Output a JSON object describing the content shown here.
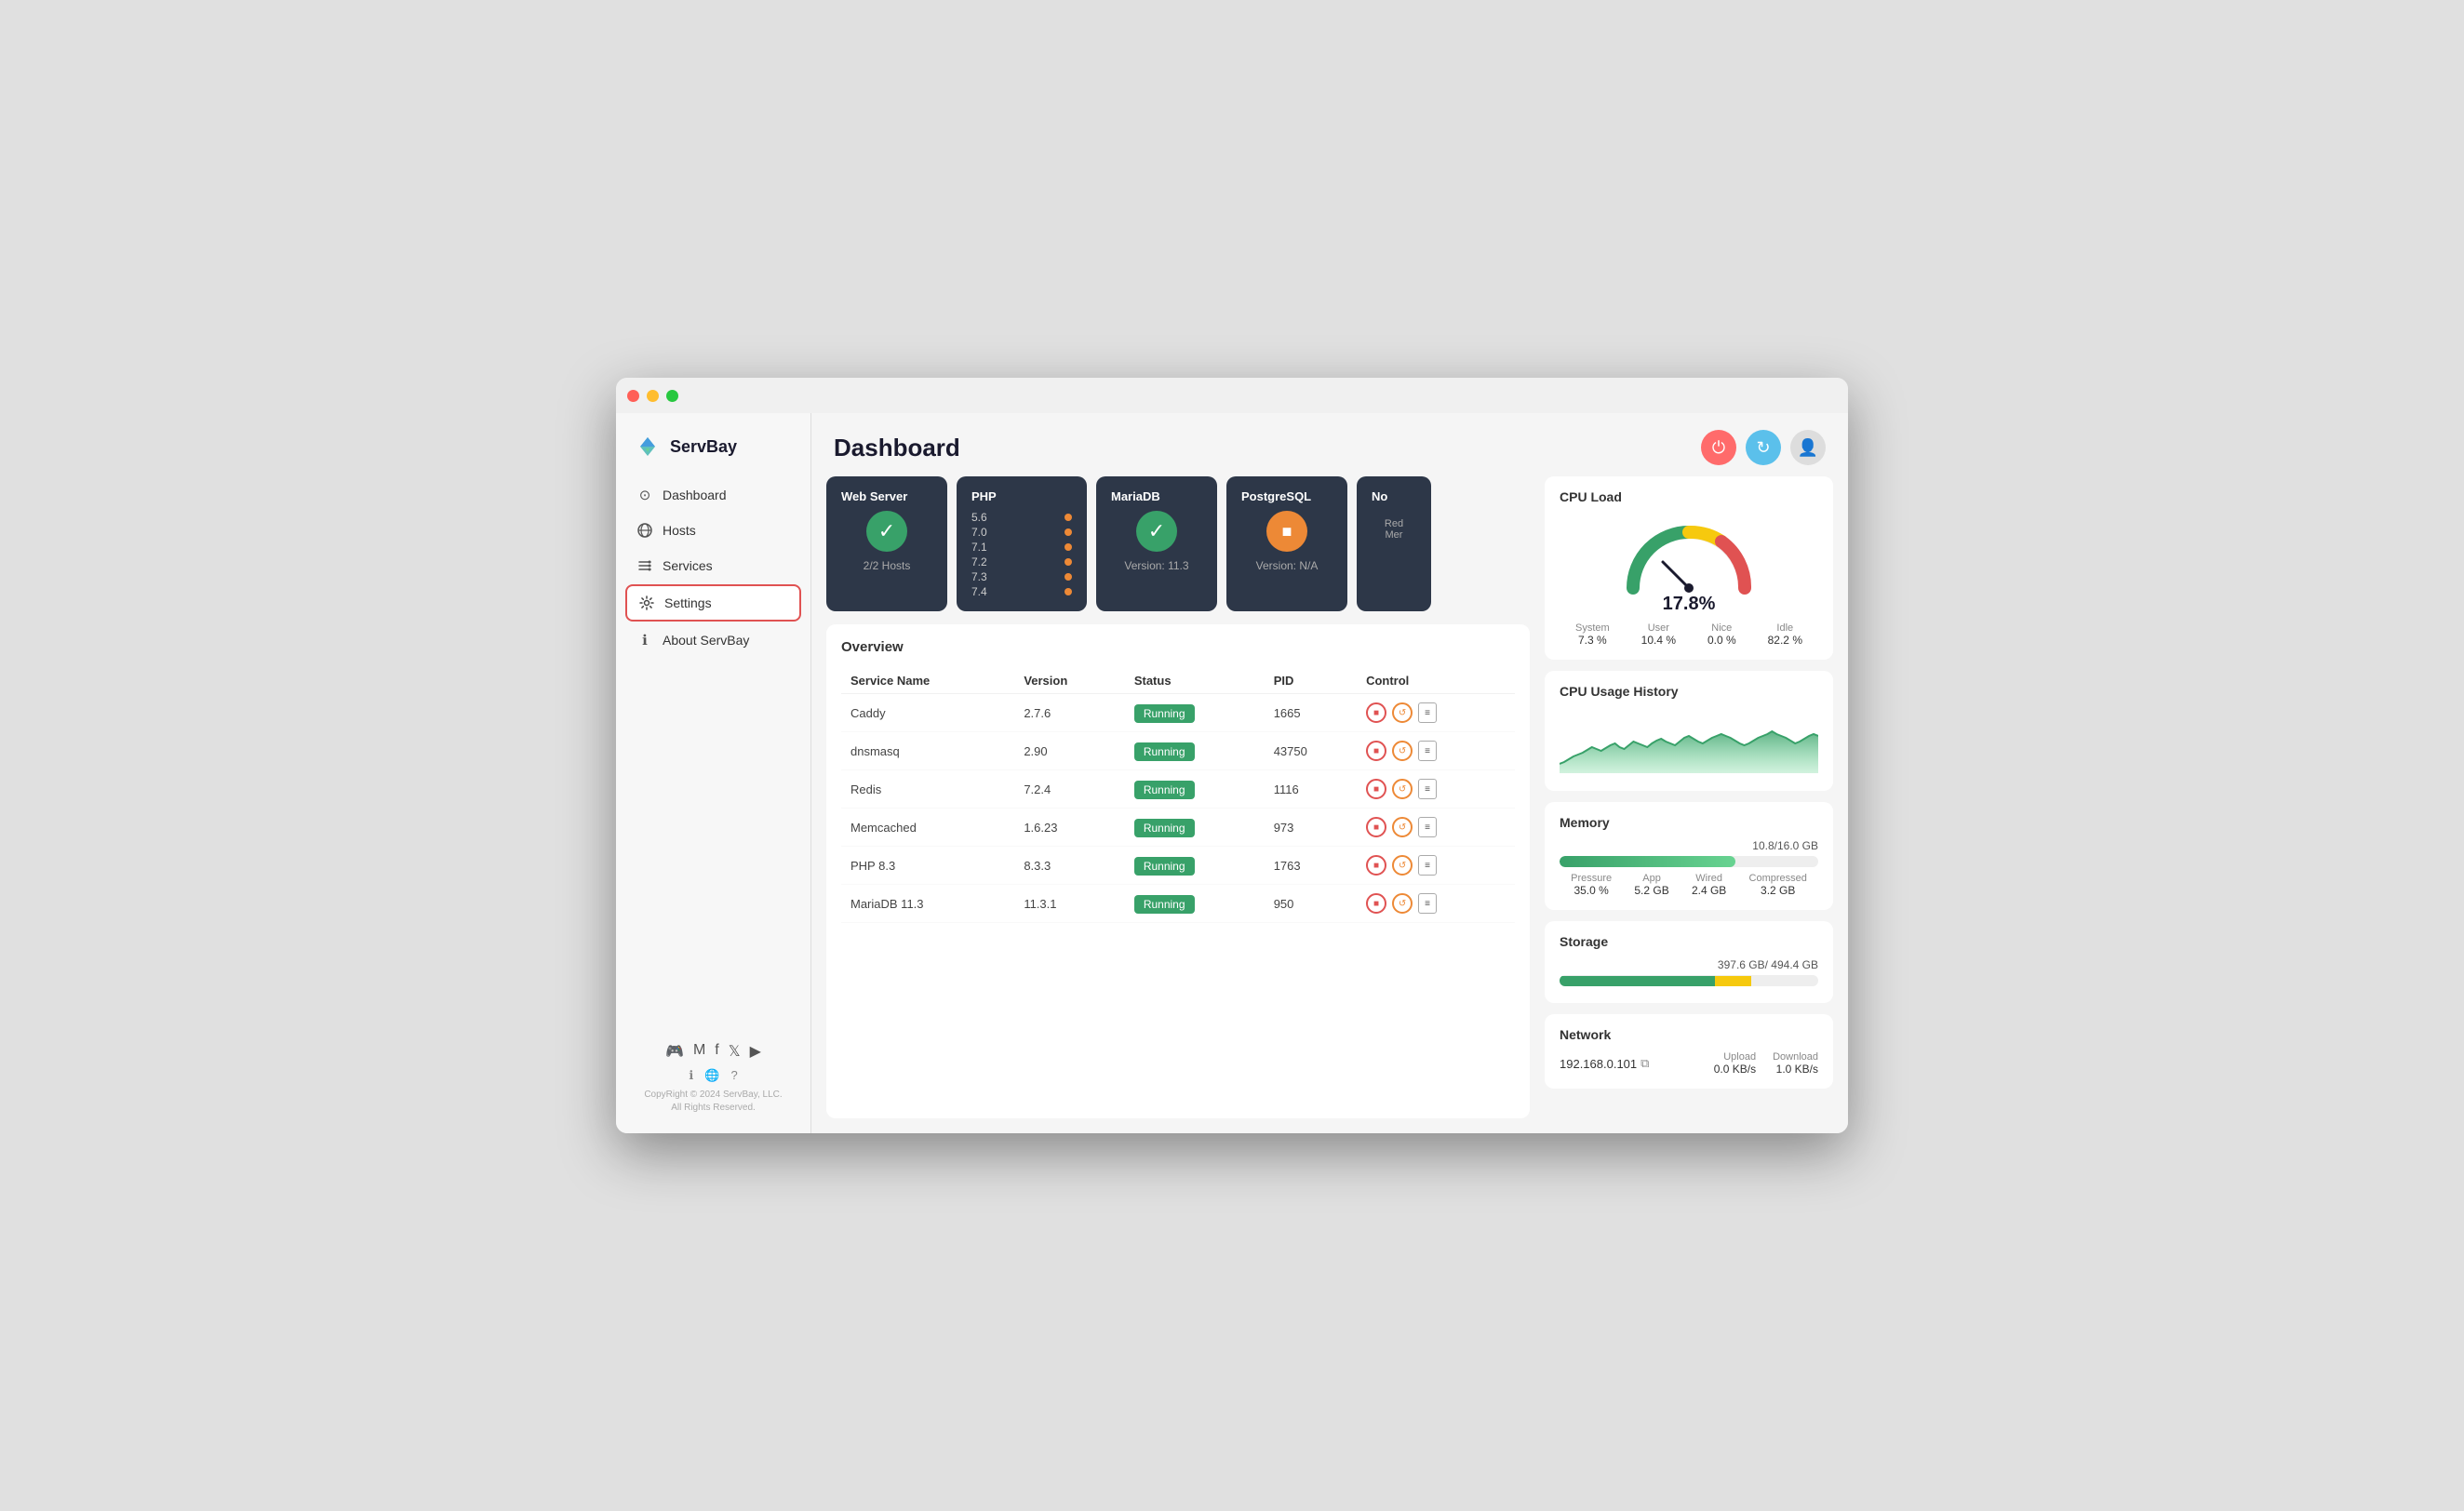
{
  "window": {
    "title": "ServBay Dashboard"
  },
  "sidebar": {
    "logo": "ServBay",
    "nav_items": [
      {
        "id": "dashboard",
        "label": "Dashboard",
        "icon": "⊙",
        "active": false
      },
      {
        "id": "hosts",
        "label": "Hosts",
        "icon": "🌐",
        "active": false
      },
      {
        "id": "services",
        "label": "Services",
        "icon": "⚙",
        "active": false
      },
      {
        "id": "settings",
        "label": "Settings",
        "icon": "⚙",
        "active": true
      },
      {
        "id": "about",
        "label": "About ServBay",
        "icon": "ℹ",
        "active": false
      }
    ],
    "social": [
      "discord",
      "medium",
      "facebook",
      "x",
      "youtube"
    ],
    "footer_links": [
      "ℹ",
      "🌐",
      "?"
    ],
    "copyright": "CopyRight © 2024 ServBay, LLC.\nAll Rights Reserved."
  },
  "header": {
    "title": "Dashboard",
    "buttons": {
      "power": "⏻",
      "refresh": "↻",
      "user": "👤"
    }
  },
  "service_cards": [
    {
      "title": "Web Server",
      "status": "green",
      "icon": "✓",
      "subtitle": "2/2 Hosts"
    },
    {
      "title": "PHP",
      "status": "php",
      "versions": [
        "5.6",
        "7.0",
        "7.1",
        "7.2",
        "7.3",
        "7.4"
      ]
    },
    {
      "title": "MariaDB",
      "status": "green",
      "icon": "✓",
      "subtitle": "Version: 11.3"
    },
    {
      "title": "PostgreSQL",
      "status": "orange",
      "icon": "■",
      "subtitle": "Version: N/A"
    },
    {
      "title": "No",
      "status": "partial",
      "subtitle": "Red\nMer"
    }
  ],
  "overview": {
    "title": "Overview",
    "table": {
      "headers": [
        "Service Name",
        "Version",
        "Status",
        "PID",
        "Control"
      ],
      "rows": [
        {
          "name": "Caddy",
          "version": "2.7.6",
          "status": "Running",
          "pid": "1665"
        },
        {
          "name": "dnsmasq",
          "version": "2.90",
          "status": "Running",
          "pid": "43750"
        },
        {
          "name": "Redis",
          "version": "7.2.4",
          "status": "Running",
          "pid": "1116"
        },
        {
          "name": "Memcached",
          "version": "1.6.23",
          "status": "Running",
          "pid": "973"
        },
        {
          "name": "PHP 8.3",
          "version": "8.3.3",
          "status": "Running",
          "pid": "1763"
        },
        {
          "name": "MariaDB 11.3",
          "version": "11.3.1",
          "status": "Running",
          "pid": "950"
        }
      ]
    }
  },
  "metrics": {
    "cpu_load": {
      "title": "CPU Load",
      "value": "17.8%",
      "stats": {
        "system": {
          "label": "System",
          "value": "7.3 %"
        },
        "user": {
          "label": "User",
          "value": "10.4 %"
        },
        "nice": {
          "label": "Nice",
          "value": "0.0 %"
        },
        "idle": {
          "label": "Idle",
          "value": "82.2 %"
        }
      }
    },
    "cpu_history": {
      "title": "CPU Usage History"
    },
    "memory": {
      "title": "Memory",
      "bar_percent": 68,
      "label": "10.8/16.0 GB",
      "stats": {
        "pressure": {
          "label": "Pressure",
          "value": "35.0 %"
        },
        "app": {
          "label": "App",
          "value": "5.2 GB"
        },
        "wired": {
          "label": "Wired",
          "value": "2.4 GB"
        },
        "compressed": {
          "label": "Compressed",
          "value": "3.2 GB"
        }
      }
    },
    "storage": {
      "title": "Storage",
      "label": "397.6 GB/ 494.4 GB"
    },
    "network": {
      "title": "Network",
      "ip": "192.168.0.101",
      "upload_label": "Upload",
      "upload_value": "0.0 KB/s",
      "download_label": "Download",
      "download_value": "1.0 KB/s"
    }
  }
}
